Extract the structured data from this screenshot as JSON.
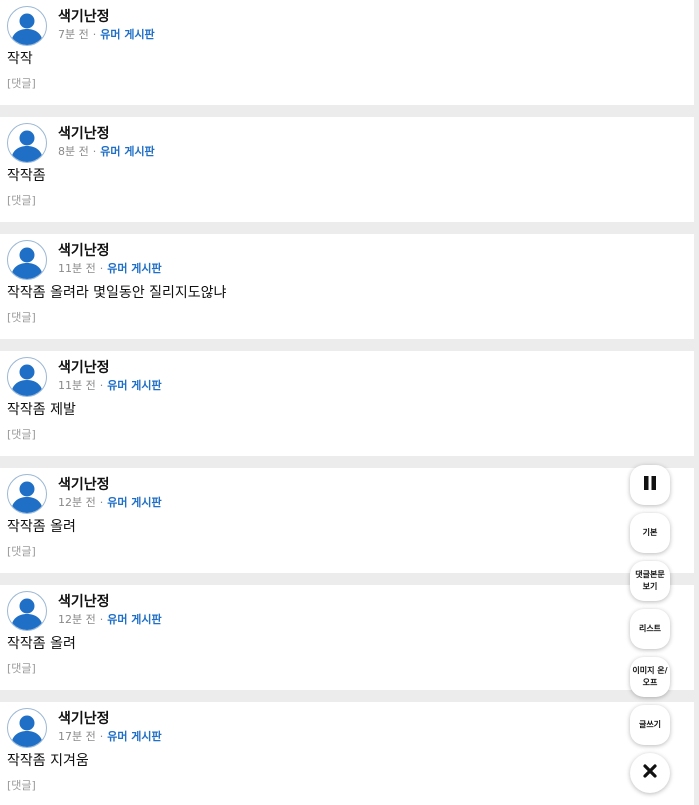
{
  "posts": [
    {
      "author": "색기난정",
      "time": "7분 전",
      "board": "유머 게시판",
      "content": "작작",
      "comment": "[댓글]"
    },
    {
      "author": "색기난정",
      "time": "8분 전",
      "board": "유머 게시판",
      "content": "작작좀",
      "comment": "[댓글]"
    },
    {
      "author": "색기난정",
      "time": "11분 전",
      "board": "유머 게시판",
      "content": "작작좀 올려라 몇일동안 질리지도않냐",
      "comment": "[댓글]"
    },
    {
      "author": "색기난정",
      "time": "11분 전",
      "board": "유머 게시판",
      "content": "작작좀 제발",
      "comment": "[댓글]"
    },
    {
      "author": "색기난정",
      "time": "12분 전",
      "board": "유머 게시판",
      "content": "작작좀 올려",
      "comment": "[댓글]"
    },
    {
      "author": "색기난정",
      "time": "12분 전",
      "board": "유머 게시판",
      "content": "작작좀 올려",
      "comment": "[댓글]"
    },
    {
      "author": "색기난정",
      "time": "17분 전",
      "board": "유머 게시판",
      "content": "작작좀 지겨움",
      "comment": "[댓글]"
    }
  ],
  "meta_separator": "·",
  "fab": {
    "pause_icon": "pause-icon",
    "basic": "기본",
    "comment_view": "댓글본문보기",
    "list": "리스트",
    "image_toggle": "이미지 온/오프",
    "write": "글쓰기",
    "close_icon": "close-icon"
  },
  "colors": {
    "board_link": "#1f6fc7",
    "avatar_fill": "#1f6fc7",
    "divider": "#ececec"
  }
}
